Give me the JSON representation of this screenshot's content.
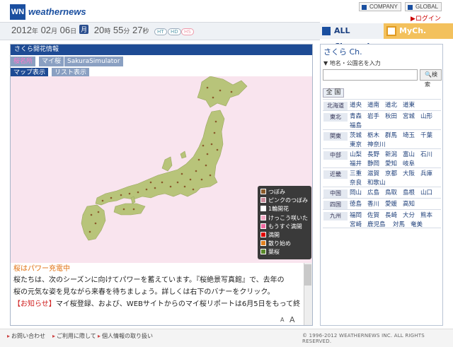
{
  "header": {
    "logo_mark": "WN",
    "logo_text": "weathernews",
    "company_link": "COMPANY",
    "global_link": "GLOBAL",
    "login": "ログイン"
  },
  "datebar": {
    "year": "2012",
    "year_unit": "年",
    "month": "02",
    "month_unit": "月",
    "day": "06",
    "day_unit": "日",
    "weekday": "月",
    "hour": "20",
    "hour_unit": "時",
    "minute": "55",
    "minute_unit": "分",
    "second": "27",
    "second_unit": "秒",
    "pills": [
      "HT",
      "HD",
      "HS"
    ]
  },
  "tabs": {
    "all_channel": "ALL Channel",
    "my_channel": "MyCh."
  },
  "left_panel": {
    "title": "さくら開花情報",
    "subtabs_row1": [
      "桜名所",
      "マイ桜",
      "SakuraSimulator"
    ],
    "subtabs_row2": [
      "マップ表示",
      "リスト表示"
    ],
    "legend": [
      {
        "label": "つぼみ",
        "color": "#8a5a2b"
      },
      {
        "label": "ピンクのつぼみ",
        "color": "#c98a9a"
      },
      {
        "label": "1輪開花",
        "color": "#ffffff"
      },
      {
        "label": "けっこう咲いた",
        "color": "#f2a8c4"
      },
      {
        "label": "もうすぐ満開",
        "color": "#f06aa0"
      },
      {
        "label": "満開",
        "color": "#e00000"
      },
      {
        "label": "散り始め",
        "color": "#e08020"
      },
      {
        "label": "葉桜",
        "color": "#5a8a2b"
      }
    ],
    "info_title": "桜はパワー充電中",
    "info_lines": [
      "桜たちは、次のシーズンに向けてパワーを蓄えています。『桜絶景写真館』で、去年の",
      "桜の元気な姿を見ながら来春を待ちましょう。詳しくは右下のバナーをクリック。"
    ],
    "notice_label": "【お知らせ】",
    "notice_text": "マイ桜登録、および、WEBサイトからのマイ桜リポートは6月5日をもって終",
    "font_small": "A",
    "font_large": "A"
  },
  "right_panel": {
    "title": "さくら Ch.",
    "search_label": "▼ 地名・公園名を入力",
    "search_value": "",
    "search_button": "検索",
    "all_button": "全 国",
    "regions": [
      {
        "name": "北海道",
        "prefs": [
          "道央",
          "道南",
          "道北",
          "道東"
        ]
      },
      {
        "name": "東北",
        "prefs": [
          "青森",
          "岩手",
          "秋田",
          "宮城",
          "山形",
          "福島"
        ]
      },
      {
        "name": "関東",
        "prefs": [
          "茨城",
          "栃木",
          "群馬",
          "埼玉",
          "千葉",
          "東京",
          "神奈川"
        ]
      },
      {
        "name": "中部",
        "prefs": [
          "山梨",
          "長野",
          "新潟",
          "富山",
          "石川",
          "福井",
          "静岡",
          "愛知",
          "岐阜"
        ]
      },
      {
        "name": "近畿",
        "prefs": [
          "三重",
          "滋賀",
          "京都",
          "大阪",
          "兵庫",
          "奈良",
          "和歌山"
        ]
      },
      {
        "name": "中国",
        "prefs": [
          "岡山",
          "広島",
          "鳥取",
          "島根",
          "山口"
        ]
      },
      {
        "name": "四国",
        "prefs": [
          "徳島",
          "香川",
          "愛媛",
          "高知"
        ]
      },
      {
        "name": "九州",
        "prefs": [
          "福岡",
          "佐賀",
          "長崎",
          "大分",
          "熊本",
          "宮崎",
          "鹿児島",
          "対馬",
          "奄美"
        ]
      }
    ]
  },
  "footer": {
    "contact": "お問い合わせ",
    "usage": "ご利用に際して",
    "privacy": "個人情報の取り扱い",
    "copyright": "© 1996-2012 WEATHERNEWS INC. ALL RIGHTS RESERVED."
  },
  "colors": {
    "brand_blue": "#1e4b94",
    "map_background": "#f9e4ee",
    "land": "#b8c47a",
    "mych_tab": "#f3c15d"
  }
}
